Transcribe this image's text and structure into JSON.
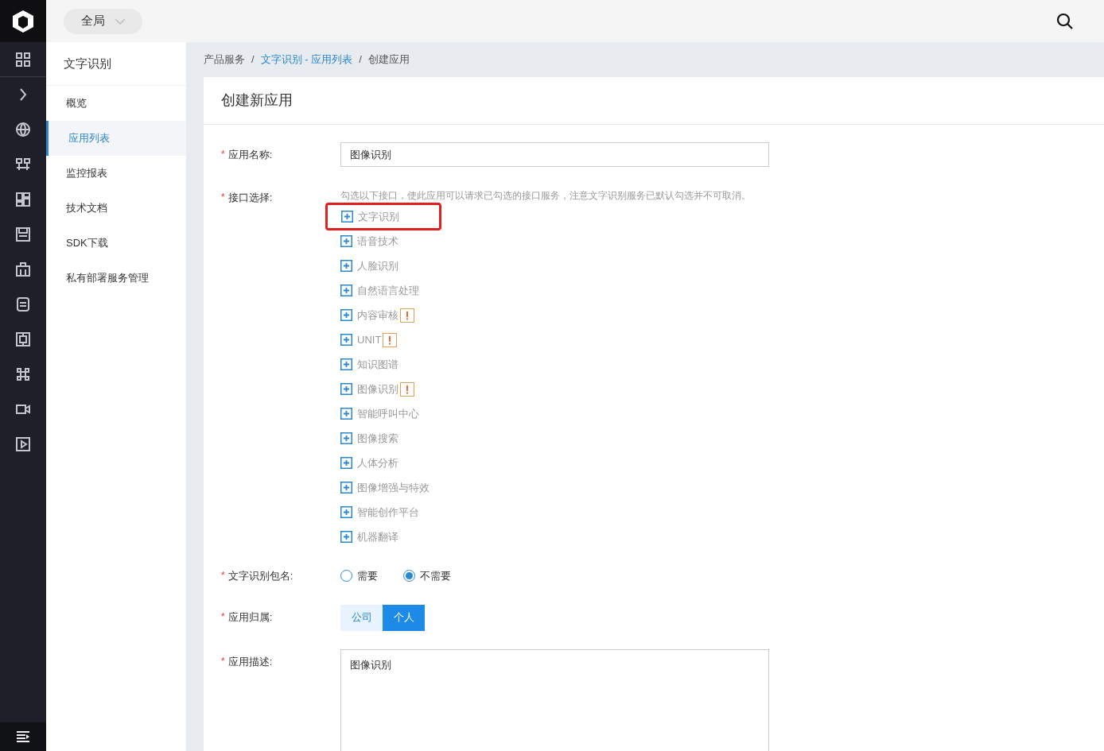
{
  "header": {
    "scope_selector": "全局"
  },
  "sidebar": {
    "title": "文字识别",
    "items": [
      {
        "label": "概览",
        "selected": false
      },
      {
        "label": "应用列表",
        "selected": true
      },
      {
        "label": "监控报表",
        "selected": false
      },
      {
        "label": "技术文档",
        "selected": false
      },
      {
        "label": "SDK下载",
        "selected": false
      },
      {
        "label": "私有部署服务管理",
        "selected": false
      }
    ]
  },
  "breadcrumb": [
    {
      "label": "产品服务",
      "kind": "text"
    },
    {
      "label": "/",
      "kind": "separator"
    },
    {
      "label": "文字识别 - 应用列表",
      "kind": "link"
    },
    {
      "label": "/",
      "kind": "separator"
    },
    {
      "label": "创建应用",
      "kind": "text"
    }
  ],
  "form": {
    "title": "创建新应用",
    "fields": [
      {
        "kind": "input",
        "label": "应用名称:",
        "required_mark": "*",
        "value": "图像识别"
      },
      {
        "kind": "apis",
        "label": "接口选择:",
        "required_mark": "*",
        "hint": "勾选以下接口，使此应用可以请求已勾选的接口服务，注意文字识别服务已默认勾选并不可取消。",
        "items": [
          {
            "label": "文字识别",
            "warning": false,
            "highlighted": true
          },
          {
            "label": "语音技术",
            "warning": false,
            "highlighted": false
          },
          {
            "label": "人脸识别",
            "warning": false,
            "highlighted": false
          },
          {
            "label": "自然语言处理",
            "warning": false,
            "highlighted": false
          },
          {
            "label": "内容审核",
            "warning": true,
            "highlighted": false
          },
          {
            "label": "UNIT",
            "warning": true,
            "highlighted": false
          },
          {
            "label": "知识图谱",
            "warning": false,
            "highlighted": false
          },
          {
            "label": "图像识别",
            "warning": true,
            "highlighted": false
          },
          {
            "label": "智能呼叫中心",
            "warning": false,
            "highlighted": false
          },
          {
            "label": "图像搜索",
            "warning": false,
            "highlighted": false
          },
          {
            "label": "人体分析",
            "warning": false,
            "highlighted": false
          },
          {
            "label": "图像增强与特效",
            "warning": false,
            "highlighted": false
          },
          {
            "label": "智能创作平台",
            "warning": false,
            "highlighted": false
          },
          {
            "label": "机器翻译",
            "warning": false,
            "highlighted": false
          }
        ]
      },
      {
        "kind": "radio",
        "label": "文字识别包名:",
        "required_mark": "*",
        "options": [
          {
            "label": "需要",
            "selected": false
          },
          {
            "label": "不需要",
            "selected": true
          }
        ]
      },
      {
        "kind": "segmented",
        "label": "应用归属:",
        "required_mark": "*",
        "options": [
          {
            "label": "公司",
            "selected": false
          },
          {
            "label": "个人",
            "selected": true
          }
        ]
      },
      {
        "kind": "textarea",
        "label": "应用描述:",
        "required_mark": "*",
        "value": "图像识别"
      }
    ]
  }
}
